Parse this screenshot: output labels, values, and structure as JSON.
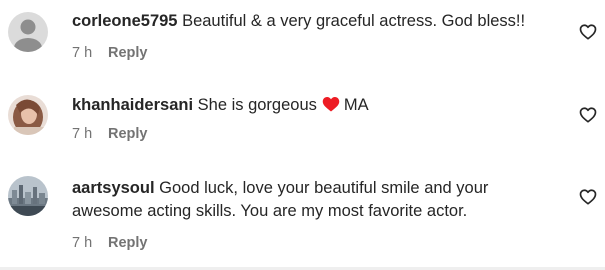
{
  "comments": [
    {
      "username": "corleone5795",
      "text": "Beautiful & a very graceful actress. God bless!!",
      "time": "7 h",
      "reply_label": "Reply",
      "avatar": "default-avatar-icon"
    },
    {
      "username": "khanhaidersani",
      "text_before": "She is gorgeous",
      "emoji": "red-heart-icon",
      "text_after": "MA",
      "time": "7 h",
      "reply_label": "Reply",
      "avatar": "profile-photo"
    },
    {
      "username": "aartsysoul",
      "text": "Good luck, love your beautiful smile and your awesome acting skills. You are my most favorite actor.",
      "time": "7 h",
      "reply_label": "Reply",
      "avatar": "city-skyline-photo"
    }
  ],
  "colors": {
    "text": "#262626",
    "secondary": "#737373",
    "heart": "#ed1c24"
  }
}
